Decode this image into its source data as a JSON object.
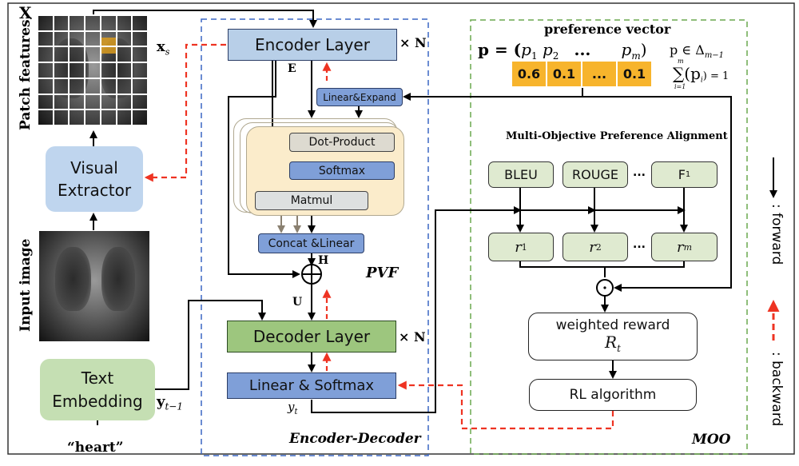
{
  "left_panel": {
    "patch_features_label": "Patch features,",
    "X_label": "X",
    "xs_label": "x",
    "xs_sub": "s",
    "visual_extractor": "Visual Extractor",
    "visual_extractor_line1": "Visual",
    "visual_extractor_line2": "Extractor",
    "input_image_label": "Input image",
    "text_embedding_line1": "Text",
    "text_embedding_line2": "Embedding",
    "y_prev_label": "y",
    "y_prev_sub": "t−1",
    "input_word": "“heart”"
  },
  "encoder_decoder": {
    "section_label": "Encoder-Decoder",
    "encoder_layer": "Encoder Layer",
    "times_n": "× N",
    "E_label": "E",
    "pvf": {
      "section_label": "PVF",
      "linear_expand": "Linear&Expand",
      "dot_product": "Dot-Product",
      "softmax": "Softmax",
      "matmul": "Matmul",
      "concat_linear": "Concat &Linear",
      "H_label": "H",
      "plus_symbol": "⊕"
    },
    "U_label": "U",
    "decoder_layer": "Decoder Layer",
    "linear_softmax": "Linear & Softmax",
    "y_t_label": "y",
    "y_t_sub": "t"
  },
  "moo": {
    "section_label": "MOO",
    "preference_vector": {
      "title": "preference vector",
      "equation_lhs": "p = (",
      "p1": "p",
      "p1_sub": "1",
      "p2": "p",
      "p2_sub": "2",
      "ellipsis": "...",
      "pm": "p",
      "pm_sub": "m",
      "close_paren": ")",
      "simplex": "p ∈ Δ",
      "simplex_sub": "m−1",
      "sum_constraint": "∑(p",
      "sum_constraint_sub": "i",
      "sum_constraint_tail": ") = 1",
      "sum_upper": "m",
      "sum_lower": "i=1",
      "values": [
        "0.6",
        "0.1",
        "...",
        "0.1"
      ]
    },
    "alignment": {
      "title": "Multi-Objective Preference Alignment",
      "metrics": [
        "BLEU",
        "ROUGE",
        "F"
      ],
      "metric_f1_sub": "1",
      "dots": "...",
      "rewards": [
        {
          "base": "r",
          "sup": "1"
        },
        {
          "base": "r",
          "sup": "2"
        },
        {
          "base": "r",
          "sup": "m"
        }
      ]
    },
    "odot_symbol": "⊙",
    "weighted_reward_line1": "weighted reward",
    "weighted_reward_R": "R",
    "weighted_reward_sub": "t",
    "rl_algorithm": "RL algorithm"
  },
  "legend": {
    "forward": ": forward",
    "backward": ": backward"
  },
  "colors": {
    "encoder_blue": "#b8cfe8",
    "visual_extractor_blue": "#bfd5ee",
    "module_blue": "#7f9fd8",
    "gray_box": "#dde0e0",
    "decoder_green": "#9dc67e",
    "text_embed_green": "#c5dfb3",
    "pvf_bg": "#fbeccb",
    "moo_bg": "#dfead0",
    "orange": "#f7b42c",
    "highlight_patch": "#d99b1f",
    "dash_blue": "#3a66c4",
    "dash_green": "#6aa84f",
    "backward_red": "#ee3322"
  }
}
